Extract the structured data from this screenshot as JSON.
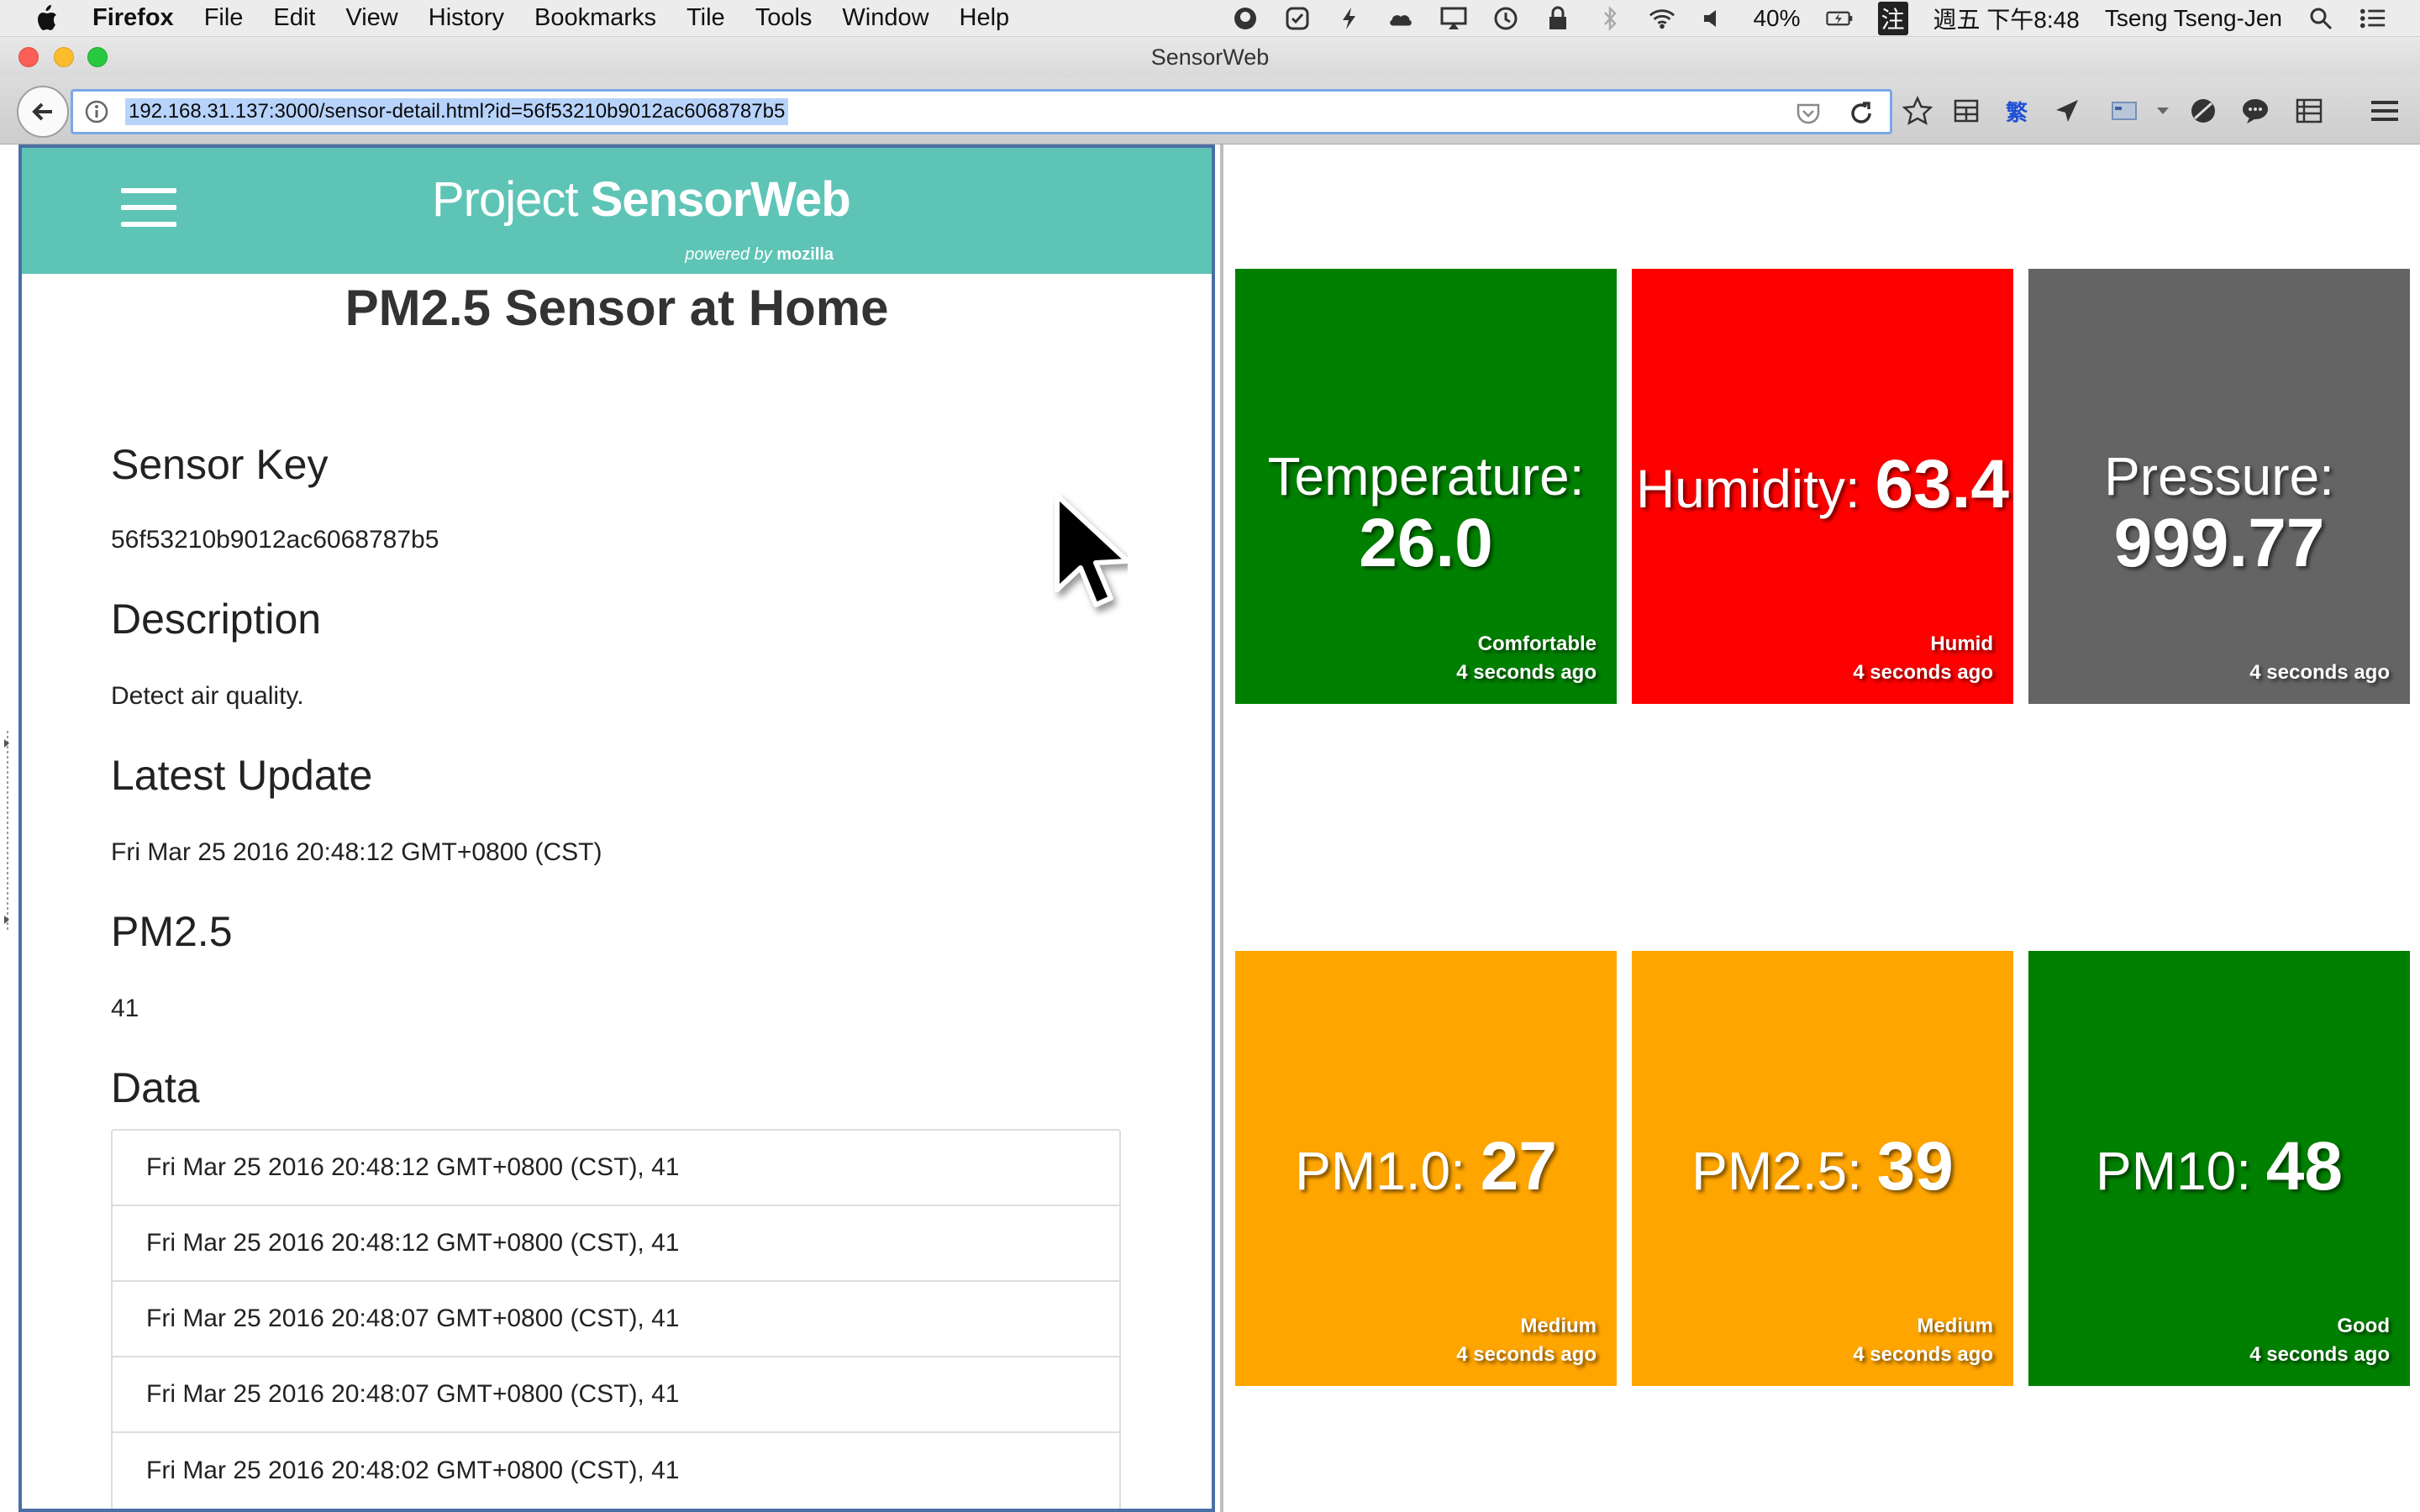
{
  "menubar": {
    "app_name": "Firefox",
    "items": [
      "File",
      "Edit",
      "View",
      "History",
      "Bookmarks",
      "Tile",
      "Tools",
      "Window",
      "Help"
    ],
    "battery": "40%",
    "ime": "注",
    "clock": "週五 下午8:48",
    "user": "Tseng Tseng-Jen"
  },
  "window": {
    "title": "SensorWeb",
    "url": "192.168.31.137:3000/sensor-detail.html?id=56f53210b9012ac6068787b5"
  },
  "app": {
    "logo_light": "Project ",
    "logo_bold": "SensorWeb",
    "logo_powered": "powered by ",
    "logo_brand": "mozilla"
  },
  "detail": {
    "title": "PM2.5 Sensor at Home",
    "sensor_key_heading": "Sensor Key",
    "sensor_key": "56f53210b9012ac6068787b5",
    "description_heading": "Description",
    "description": "Detect air quality.",
    "latest_update_heading": "Latest Update",
    "latest_update": "Fri Mar 25 2016 20:48:12 GMT+0800 (CST)",
    "pm25_heading": "PM2.5",
    "pm25": "41",
    "data_heading": "Data",
    "data": [
      "Fri Mar 25 2016 20:48:12 GMT+0800 (CST), 41",
      "Fri Mar 25 2016 20:48:12 GMT+0800 (CST), 41",
      "Fri Mar 25 2016 20:48:07 GMT+0800 (CST), 41",
      "Fri Mar 25 2016 20:48:07 GMT+0800 (CST), 41",
      "Fri Mar 25 2016 20:48:02 GMT+0800 (CST), 41"
    ]
  },
  "tiles": [
    {
      "label": "Temperature:",
      "value": "26.0",
      "status": "Comfortable",
      "updated": "4 seconds ago",
      "color": "#008000"
    },
    {
      "label": "Humidity: ",
      "value": "63.4",
      "status": "Humid",
      "updated": "4 seconds ago",
      "color": "#ff0000"
    },
    {
      "label": "Pressure:",
      "value": "999.77",
      "status": "",
      "updated": "4 seconds ago",
      "color": "#646464"
    },
    {
      "label": "PM1.0: ",
      "value": "27",
      "status": "Medium",
      "updated": "4 seconds ago",
      "color": "#ffa500"
    },
    {
      "label": "PM2.5: ",
      "value": "39",
      "status": "Medium",
      "updated": "4 seconds ago",
      "color": "#ffa500"
    },
    {
      "label": "PM10: ",
      "value": "48",
      "status": "Good",
      "updated": "4 seconds ago",
      "color": "#008000"
    }
  ],
  "colors": {
    "header": "#5ec4b6",
    "url_highlight": "#b7d3fb",
    "pane_border": "#4a6fa5"
  }
}
